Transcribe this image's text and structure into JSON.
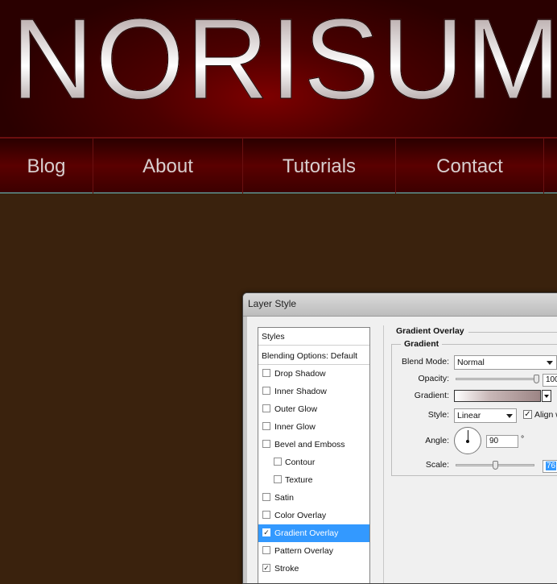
{
  "site": {
    "logo_text": "NORISUM",
    "nav": [
      {
        "label": "Blog"
      },
      {
        "label": "About"
      },
      {
        "label": "Tutorials"
      },
      {
        "label": "Contact"
      }
    ]
  },
  "dialog": {
    "title": "Layer Style",
    "styles_header": "Styles",
    "blending_options": "Blending Options: Default",
    "style_items": [
      {
        "label": "Drop Shadow",
        "checked": false
      },
      {
        "label": "Inner Shadow",
        "checked": false
      },
      {
        "label": "Outer Glow",
        "checked": false
      },
      {
        "label": "Inner Glow",
        "checked": false
      },
      {
        "label": "Bevel and Emboss",
        "checked": false
      },
      {
        "label": "Contour",
        "checked": false
      },
      {
        "label": "Texture",
        "checked": false
      },
      {
        "label": "Satin",
        "checked": false
      },
      {
        "label": "Color Overlay",
        "checked": false
      },
      {
        "label": "Gradient Overlay",
        "checked": true
      },
      {
        "label": "Pattern Overlay",
        "checked": false
      },
      {
        "label": "Stroke",
        "checked": true
      }
    ],
    "section_title": "Gradient Overlay",
    "group_title": "Gradient",
    "blend_mode": {
      "label": "Blend Mode:",
      "value": "Normal"
    },
    "opacity": {
      "label": "Opacity:",
      "value": "100",
      "level_percent": 100
    },
    "gradient": {
      "label": "Gradient:",
      "colors": [
        "#ffffff",
        "#c9b8b8",
        "#9d8585"
      ]
    },
    "style": {
      "label": "Style:",
      "value": "Linear"
    },
    "align": {
      "label": "Align w",
      "checked": true
    },
    "angle": {
      "label": "Angle:",
      "value": "90",
      "unit": "°"
    },
    "scale": {
      "label": "Scale:",
      "value": "76",
      "level_percent": 76
    },
    "check_mark": "✓"
  },
  "colors": {
    "header_red": "#7d0000",
    "body_brown": "#3a220d",
    "selection_blue": "#3399ff",
    "nav_underline": "#6ac7c7"
  }
}
